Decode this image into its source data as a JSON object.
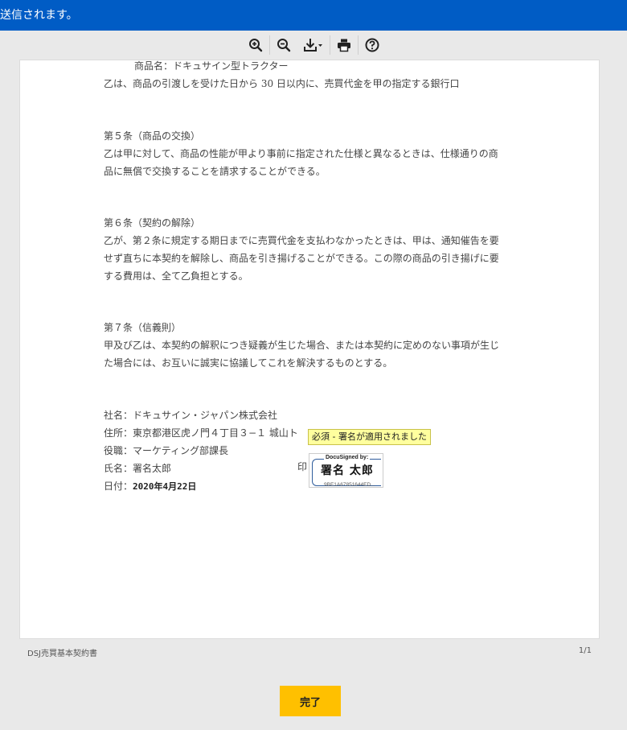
{
  "banner": {
    "text": "送信されます。",
    "bg_color": "#005cc5"
  },
  "toolbar": {
    "buttons": [
      {
        "icon": "zoom-in-icon"
      },
      {
        "icon": "zoom-out-icon"
      },
      {
        "icon": "download-icon"
      },
      {
        "icon": "print-icon"
      },
      {
        "icon": "help-icon"
      }
    ]
  },
  "document": {
    "lines": {
      "product_name": "商品名：ドキュサイン型トラクター",
      "payment": "乙は、商品の引渡しを受けた日から 30 日以内に、売買代金を甲の指定する銀行口",
      "art5_title": "第５条（商品の交換）",
      "art5_l1": "乙は甲に対して、商品の性能が甲より事前に指定された仕様と異なるときは、仕様通りの商",
      "art5_l2": "品に無償で交換することを請求することができる。",
      "art6_title": "第６条（契約の解除）",
      "art6_l1": "乙が、第２条に規定する期日までに売買代金を支払わなかったときは、甲は、通知催告を要",
      "art6_l2": "せず直ちに本契約を解除し、商品を引き揚げることができる。この際の商品の引き揚げに要",
      "art6_l3": "する費用は、全て乙負担とする。",
      "art7_title": "第７条（信義則）",
      "art7_l1": "甲及び乙は、本契約の解釈につき疑義が生じた場合、または本契約に定めのない事項が生じ",
      "art7_l2": "た場合には、お互いに誠実に協議してこれを解決するものとする。",
      "company": "社名：ドキュサイン・ジャパン株式会社",
      "address": "住所：東京都港区虎ノ門４丁目３−１ 城山ト",
      "title": "役職：マーケティング部課長",
      "name": "氏名：署名太郎",
      "date_label": "日付：",
      "date_value": "2020年4月22日"
    },
    "seal_label": "印",
    "tooltip": "必須 - 署名が適用されました",
    "stamp": {
      "header": "DocuSigned by:",
      "name": "署名 太郎",
      "id": "9BE1A67851644ED..."
    }
  },
  "footer": {
    "doc_name": "DSJ売買基本契約書",
    "page_count": "1/1"
  },
  "done_button": {
    "label": "完了",
    "color": "#ffc000"
  }
}
